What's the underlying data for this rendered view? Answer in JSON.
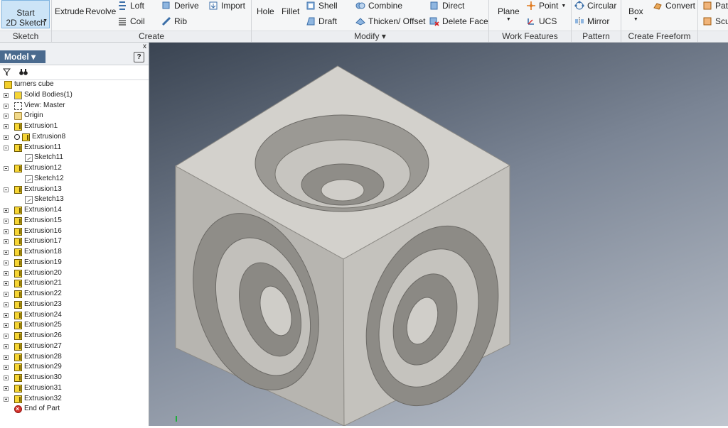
{
  "ribbon": {
    "sketch": {
      "start_label_1": "Start",
      "start_label_2": "2D Sketch",
      "panel_label": "Sketch"
    },
    "create": {
      "extrude": "Extrude",
      "revolve": "Revolve",
      "loft": "Loft",
      "coil": "Coil",
      "derive": "Derive",
      "rib": "Rib",
      "import": "Import",
      "panel_label": "Create"
    },
    "modify": {
      "hole": "Hole",
      "fillet": "Fillet",
      "shell": "Shell",
      "draft": "Draft",
      "combine": "Combine",
      "thicken": "Thicken/ Offset",
      "direct": "Direct",
      "delete_face": "Delete Face",
      "panel_label": "Modify ▾"
    },
    "work_features": {
      "plane": "Plane",
      "point": "Point",
      "ucs": "UCS",
      "panel_label": "Work Features"
    },
    "pattern": {
      "circular": "Circular",
      "mirror": "Mirror",
      "panel_label": "Pattern"
    },
    "freeform": {
      "box": "Box",
      "convert": "Convert",
      "panel_label": "Create Freeform"
    },
    "extra": {
      "pattern_cut": "Patt",
      "sculpt_cut": "Scu"
    }
  },
  "browser": {
    "title": "Model ▾",
    "close": "x",
    "help": "?",
    "items": [
      {
        "label": "turners cube",
        "icon": "part-icon"
      },
      {
        "label": "Solid Bodies(1)",
        "icon": "solid-bodies-icon"
      },
      {
        "label": "View: Master",
        "icon": "view-icon"
      },
      {
        "label": "Origin",
        "icon": "folder-icon"
      },
      {
        "label": "Extrusion1",
        "icon": "extrusion-icon"
      },
      {
        "label": "Extrusion8",
        "icon": "extrusion-icon"
      },
      {
        "label": "Extrusion11",
        "icon": "extrusion-icon"
      },
      {
        "label": "Sketch11",
        "icon": "sketch-icon"
      },
      {
        "label": "Extrusion12",
        "icon": "extrusion-icon"
      },
      {
        "label": "Sketch12",
        "icon": "sketch-icon"
      },
      {
        "label": "Extrusion13",
        "icon": "extrusion-icon"
      },
      {
        "label": "Sketch13",
        "icon": "sketch-icon"
      },
      {
        "label": "Extrusion14",
        "icon": "extrusion-icon"
      },
      {
        "label": "Extrusion15",
        "icon": "extrusion-icon"
      },
      {
        "label": "Extrusion16",
        "icon": "extrusion-icon"
      },
      {
        "label": "Extrusion17",
        "icon": "extrusion-icon"
      },
      {
        "label": "Extrusion18",
        "icon": "extrusion-icon"
      },
      {
        "label": "Extrusion19",
        "icon": "extrusion-icon"
      },
      {
        "label": "Extrusion20",
        "icon": "extrusion-icon"
      },
      {
        "label": "Extrusion21",
        "icon": "extrusion-icon"
      },
      {
        "label": "Extrusion22",
        "icon": "extrusion-icon"
      },
      {
        "label": "Extrusion23",
        "icon": "extrusion-icon"
      },
      {
        "label": "Extrusion24",
        "icon": "extrusion-icon"
      },
      {
        "label": "Extrusion25",
        "icon": "extrusion-icon"
      },
      {
        "label": "Extrusion26",
        "icon": "extrusion-icon"
      },
      {
        "label": "Extrusion27",
        "icon": "extrusion-icon"
      },
      {
        "label": "Extrusion28",
        "icon": "extrusion-icon"
      },
      {
        "label": "Extrusion29",
        "icon": "extrusion-icon"
      },
      {
        "label": "Extrusion30",
        "icon": "extrusion-icon"
      },
      {
        "label": "Extrusion31",
        "icon": "extrusion-icon"
      },
      {
        "label": "Extrusion32",
        "icon": "extrusion-icon"
      },
      {
        "label": "End of Part",
        "icon": "end-of-part-icon"
      }
    ]
  },
  "colors": {
    "accent": "#4a6a8e",
    "model_face": "#c8c6c0",
    "ribbon_bg": "#f5f6f7"
  }
}
